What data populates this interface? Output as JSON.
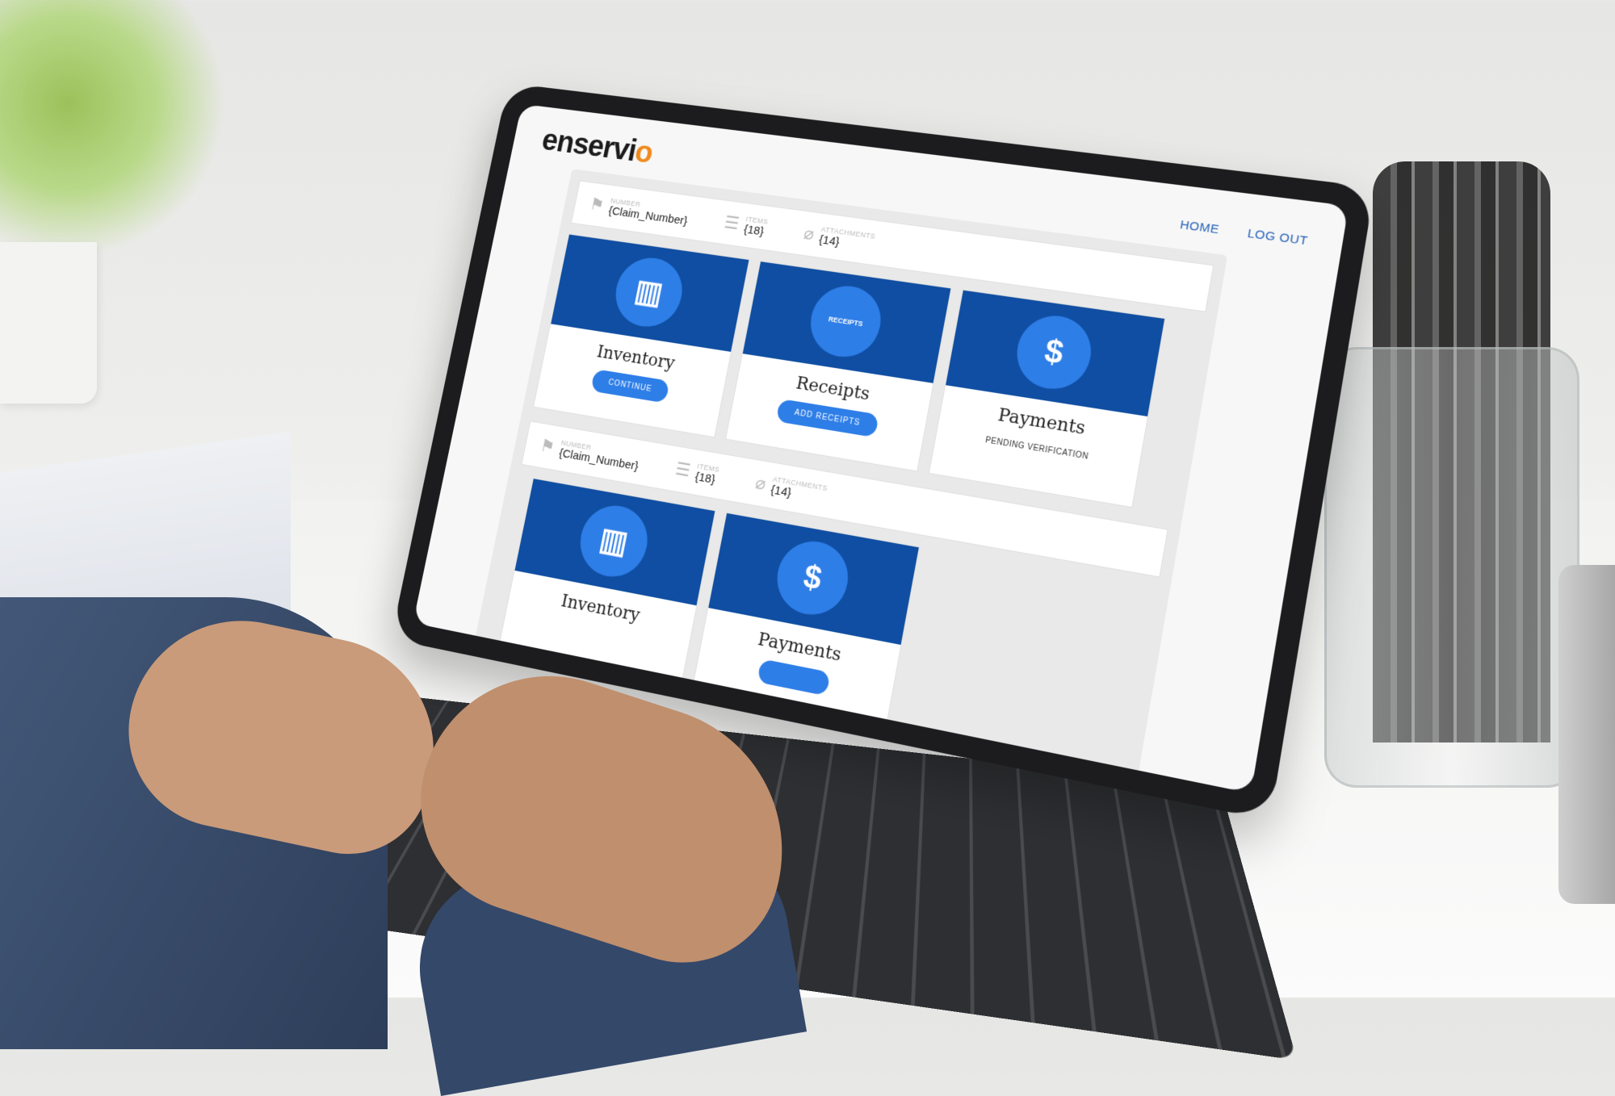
{
  "app": {
    "logo": "enservio",
    "logo_accent": "#f08a1c"
  },
  "nav": {
    "home": "HOME",
    "logout": "LOG OUT"
  },
  "colors": {
    "card_header": "#0f4ea2",
    "icon_circle": "#2e7ee8",
    "nav_link": "#2561b8"
  },
  "claims": [
    {
      "number_label": "NUMBER",
      "number": "{Claim_Number}",
      "items_label": "ITEMS",
      "items": "{18}",
      "attachments_label": "ATTACHMENTS",
      "attachments": "{14}",
      "cards": [
        {
          "title": "Inventory",
          "icon": "binders-icon",
          "action": "CONTINUE"
        },
        {
          "title": "Receipts",
          "icon": "receipt-icon",
          "icon_text": "RECEIPTS",
          "action": "ADD RECEIPTS"
        },
        {
          "title": "Payments",
          "icon": "dollar-document-icon",
          "status": "PENDING VERIFICATION"
        }
      ]
    },
    {
      "number_label": "NUMBER",
      "number": "{Claim_Number}",
      "items_label": "ITEMS",
      "items": "{18}",
      "attachments_label": "ATTACHMENTS",
      "attachments": "{14}",
      "cards": [
        {
          "title": "Inventory",
          "icon": "binders-icon"
        },
        {
          "title": "Payments",
          "icon": "dollar-document-icon"
        }
      ]
    }
  ]
}
